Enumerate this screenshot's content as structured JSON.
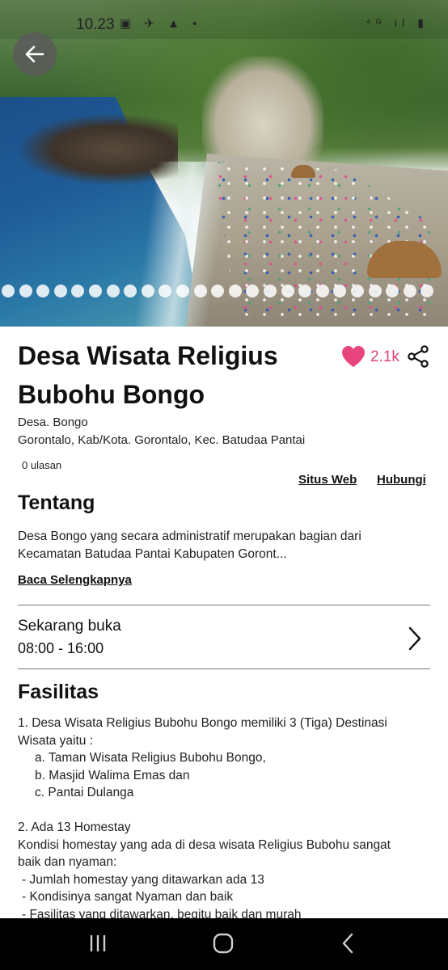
{
  "status_bar": {
    "time": "10.23",
    "icons_left": "▣ ✈ ▲ •",
    "icons_right": "⁴ᴳ ıl ▮"
  },
  "gallery": {
    "dot_count": 25,
    "active_index": 0
  },
  "place": {
    "title": "Desa Wisata Religius Bubohu Bongo",
    "likes": "2.1k",
    "village": "Desa. Bongo",
    "address": "Gorontalo, Kab/Kota. Gorontalo, Kec. Batudaa Pantai",
    "reviews": "0 ulasan",
    "website_label": "Situs Web",
    "contact_label": "Hubungi"
  },
  "about": {
    "heading": "Tentang",
    "line1": "Desa Bongo yang secara administratif merupakan bagian dari",
    "line2": "Kecamatan Batudaa Pantai Kabupaten Goront...",
    "read_more": "Baca Selengkapnya"
  },
  "hours": {
    "status": "Sekarang buka",
    "time": "08:00 - 16:00"
  },
  "facilities": {
    "heading": "Fasilitas",
    "lines": [
      "1. Desa Wisata Religius Bubohu Bongo memiliki  3 (Tiga) Destinasi",
      "Wisata yaitu :",
      "a. Taman Wisata Religius Bubohu Bongo,",
      "b. Masjid Walima Emas dan",
      "c. Pantai Dulanga",
      "",
      "2. Ada 13 Homestay",
      "Kondisi homestay yang ada di desa wisata Religius Bubohu sangat",
      "baik dan nyaman:",
      "- Jumlah homestay yang ditawarkan ada 13",
      "- Kondisinya sangat Nyaman dan baik",
      "- Fasilitas yang ditawarkan, begitu baik dan murah"
    ]
  },
  "colors": {
    "accent_pink": "#e0457b",
    "nav_bg": "#000000"
  },
  "icons": {
    "back": "arrow-left-icon",
    "like": "heart-icon",
    "share": "share-icon",
    "hours": "chevron-right-icon"
  }
}
